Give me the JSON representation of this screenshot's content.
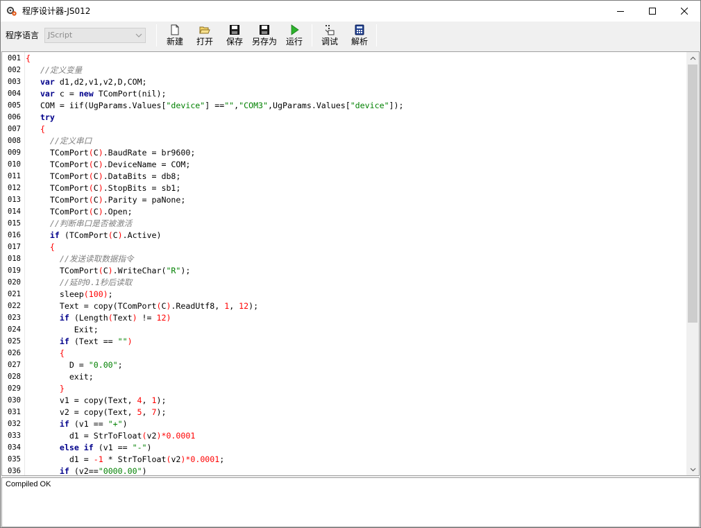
{
  "window": {
    "title": "程序设计器-JS012"
  },
  "toolbar": {
    "language_label": "程序语言",
    "language_value": "JScript",
    "buttons": {
      "new": "新建",
      "open": "打开",
      "save": "保存",
      "save_as": "另存为",
      "run": "运行",
      "debug": "调试",
      "parse": "解析"
    }
  },
  "editor": {
    "line_numbers": [
      "001",
      "002",
      "003",
      "004",
      "005",
      "006",
      "007",
      "008",
      "009",
      "010",
      "011",
      "012",
      "013",
      "014",
      "015",
      "016",
      "017",
      "018",
      "019",
      "020",
      "021",
      "022",
      "023",
      "024",
      "025",
      "026",
      "027",
      "028",
      "029",
      "030",
      "031",
      "032",
      "033",
      "034",
      "035",
      "036"
    ],
    "lines": [
      [
        [
          "{",
          "sy"
        ]
      ],
      [
        [
          "   //定义变量",
          "cm"
        ]
      ],
      [
        [
          "   ",
          ""
        ],
        [
          "var",
          "kw"
        ],
        [
          " d1,d2,v1,v2,D,COM;",
          "id"
        ]
      ],
      [
        [
          "   ",
          ""
        ],
        [
          "var",
          "kw"
        ],
        [
          " c = ",
          "id"
        ],
        [
          "new",
          "kw"
        ],
        [
          " TComPort(nil);",
          "id"
        ]
      ],
      [
        [
          "   COM = iif(UgParams.Values[",
          "id"
        ],
        [
          "\"device\"",
          "st"
        ],
        [
          "] ==",
          "id"
        ],
        [
          "\"\"",
          "st"
        ],
        [
          ",",
          "id"
        ],
        [
          "\"COM3\"",
          "st"
        ],
        [
          ",UgParams.Values[",
          "id"
        ],
        [
          "\"device\"",
          "st"
        ],
        [
          "]);",
          "id"
        ]
      ],
      [
        [
          "   ",
          ""
        ],
        [
          "try",
          "kw"
        ]
      ],
      [
        [
          "   {",
          "sy"
        ]
      ],
      [
        [
          "     //定义串口",
          "cm"
        ]
      ],
      [
        [
          "     TComPort",
          "id"
        ],
        [
          "(",
          "sy"
        ],
        [
          "C",
          "id"
        ],
        [
          ")",
          "sy"
        ],
        [
          ".BaudRate = br9600;",
          "id"
        ]
      ],
      [
        [
          "     TComPort",
          "id"
        ],
        [
          "(",
          "sy"
        ],
        [
          "C",
          "id"
        ],
        [
          ")",
          "sy"
        ],
        [
          ".DeviceName = COM;",
          "id"
        ]
      ],
      [
        [
          "     TComPort",
          "id"
        ],
        [
          "(",
          "sy"
        ],
        [
          "C",
          "id"
        ],
        [
          ")",
          "sy"
        ],
        [
          ".DataBits = db8;",
          "id"
        ]
      ],
      [
        [
          "     TComPort",
          "id"
        ],
        [
          "(",
          "sy"
        ],
        [
          "C",
          "id"
        ],
        [
          ")",
          "sy"
        ],
        [
          ".StopBits = sb1;",
          "id"
        ]
      ],
      [
        [
          "     TComPort",
          "id"
        ],
        [
          "(",
          "sy"
        ],
        [
          "C",
          "id"
        ],
        [
          ")",
          "sy"
        ],
        [
          ".Parity = paNone;",
          "id"
        ]
      ],
      [
        [
          "     TComPort",
          "id"
        ],
        [
          "(",
          "sy"
        ],
        [
          "C",
          "id"
        ],
        [
          ")",
          "sy"
        ],
        [
          ".Open;",
          "id"
        ]
      ],
      [
        [
          "     //判断串口是否被激活",
          "cm"
        ]
      ],
      [
        [
          "     ",
          ""
        ],
        [
          "if",
          "kw"
        ],
        [
          " (TComPort",
          "id"
        ],
        [
          "(",
          "sy"
        ],
        [
          "C",
          "id"
        ],
        [
          ")",
          "sy"
        ],
        [
          ".Active)",
          "id"
        ]
      ],
      [
        [
          "     {",
          "sy"
        ]
      ],
      [
        [
          "       //发送读取数据指令",
          "cm"
        ]
      ],
      [
        [
          "       TComPort",
          "id"
        ],
        [
          "(",
          "sy"
        ],
        [
          "C",
          "id"
        ],
        [
          ")",
          "sy"
        ],
        [
          ".WriteChar(",
          "id"
        ],
        [
          "\"R\"",
          "st"
        ],
        [
          ");",
          "id"
        ]
      ],
      [
        [
          "       //延时0.1秒后读取",
          "cm"
        ]
      ],
      [
        [
          "       sleep",
          "id"
        ],
        [
          "(100)",
          "sy"
        ],
        [
          ";",
          "id"
        ]
      ],
      [
        [
          "       Text = copy(TComPort",
          "id"
        ],
        [
          "(",
          "sy"
        ],
        [
          "C",
          "id"
        ],
        [
          ")",
          "sy"
        ],
        [
          ".ReadUtf8, ",
          "id"
        ],
        [
          "1",
          "nm"
        ],
        [
          ", ",
          "id"
        ],
        [
          "12",
          "nm"
        ],
        [
          ");",
          "id"
        ]
      ],
      [
        [
          "       ",
          ""
        ],
        [
          "if",
          "kw"
        ],
        [
          " (Length",
          "id"
        ],
        [
          "(",
          "sy"
        ],
        [
          "Text",
          "id"
        ],
        [
          ")",
          "sy"
        ],
        [
          " != ",
          "id"
        ],
        [
          "12",
          "nm"
        ],
        [
          ")",
          "sy"
        ]
      ],
      [
        [
          "          Exit;",
          "id"
        ]
      ],
      [
        [
          "       ",
          ""
        ],
        [
          "if",
          "kw"
        ],
        [
          " (Text == ",
          "id"
        ],
        [
          "\"\"",
          "st"
        ],
        [
          ")",
          "sy"
        ]
      ],
      [
        [
          "       {",
          "sy"
        ]
      ],
      [
        [
          "         D = ",
          "id"
        ],
        [
          "\"0.00\"",
          "st"
        ],
        [
          ";",
          "id"
        ]
      ],
      [
        [
          "         exit;",
          "id"
        ]
      ],
      [
        [
          "       }",
          "sy"
        ]
      ],
      [
        [
          "       v1 = copy(Text, ",
          "id"
        ],
        [
          "4",
          "nm"
        ],
        [
          ", ",
          "id"
        ],
        [
          "1",
          "nm"
        ],
        [
          ");",
          "id"
        ]
      ],
      [
        [
          "       v2 = copy(Text, ",
          "id"
        ],
        [
          "5",
          "nm"
        ],
        [
          ", ",
          "id"
        ],
        [
          "7",
          "nm"
        ],
        [
          ");",
          "id"
        ]
      ],
      [
        [
          "       ",
          ""
        ],
        [
          "if",
          "kw"
        ],
        [
          " (v1 == ",
          "id"
        ],
        [
          "\"+\"",
          "st"
        ],
        [
          ")",
          "id"
        ]
      ],
      [
        [
          "         d1 = StrToFloat",
          "id"
        ],
        [
          "(",
          "sy"
        ],
        [
          "v2",
          "id"
        ],
        [
          ")",
          "sy"
        ],
        [
          "*0.0001",
          "nm"
        ]
      ],
      [
        [
          "       ",
          ""
        ],
        [
          "else if",
          "kw"
        ],
        [
          " (v1 == ",
          "id"
        ],
        [
          "\"-\"",
          "st"
        ],
        [
          ")",
          "id"
        ]
      ],
      [
        [
          "         d1 = ",
          "id"
        ],
        [
          "-1",
          "nm"
        ],
        [
          " * StrToFloat",
          "id"
        ],
        [
          "(",
          "sy"
        ],
        [
          "v2",
          "id"
        ],
        [
          ")",
          "sy"
        ],
        [
          "*0.0001",
          "nm"
        ],
        [
          ";",
          "id"
        ]
      ],
      [
        [
          "       ",
          ""
        ],
        [
          "if",
          "kw"
        ],
        [
          " (v2==",
          "id"
        ],
        [
          "\"0000.00\"",
          "st"
        ],
        [
          ")",
          "id"
        ]
      ]
    ]
  },
  "status": {
    "message": "Compiled OK"
  }
}
